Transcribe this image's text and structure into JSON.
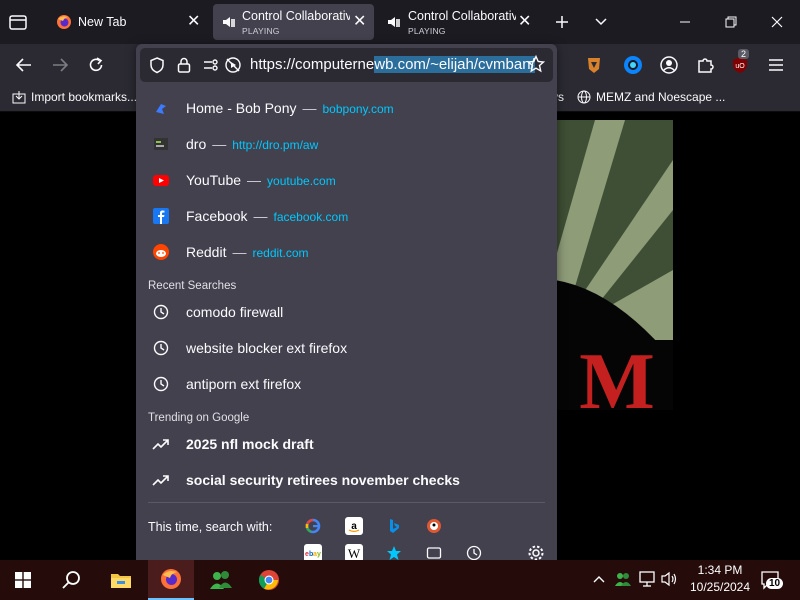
{
  "tabs": [
    {
      "title": "New Tab",
      "active": false
    },
    {
      "title": "Control Collaborativ",
      "subtitle": "PLAYING",
      "active": true
    },
    {
      "title": "Control Collaborativ",
      "subtitle": "PLAYING",
      "active": false
    }
  ],
  "url": {
    "prefix": "https://computerne",
    "selected": "wb.com/~elijah/cvmban/"
  },
  "bookmarks": [
    {
      "label": "Import bookmarks..."
    },
    {
      "label": "vs"
    },
    {
      "label": "MEMZ and Noescape ..."
    }
  ],
  "extensions_badge": "2",
  "suggestions": [
    {
      "title": "Home - Bob Pony",
      "url": "bobpony.com",
      "icon": "bobpony-icon"
    },
    {
      "title": "dro",
      "url": "http://dro.pm/aw",
      "icon": "dro-icon"
    },
    {
      "title": "YouTube",
      "url": "youtube.com",
      "icon": "youtube-icon"
    },
    {
      "title": "Facebook",
      "url": "facebook.com",
      "icon": "facebook-icon"
    },
    {
      "title": "Reddit",
      "url": "reddit.com",
      "icon": "reddit-icon"
    }
  ],
  "recent_label": "Recent Searches",
  "recent": [
    {
      "text": "comodo firewall"
    },
    {
      "text": "website blocker ext firefox"
    },
    {
      "text": "antiporn ext firefox"
    }
  ],
  "trending_label": "Trending on Google",
  "trending": [
    {
      "text": "2025 nfl mock draft"
    },
    {
      "text": "social security retirees november checks"
    }
  ],
  "search_with_label": "This time, search with:",
  "engines_row1": [
    "google-icon",
    "amazon-icon",
    "bing-icon",
    "duckduckgo-icon"
  ],
  "engines_row2": [
    "ebay-icon",
    "wikipedia-icon",
    "bookmarks-star-icon",
    "tabs-icon",
    "history-icon"
  ],
  "art_text": "M",
  "clock": {
    "time": "1:34 PM",
    "date": "10/25/2024"
  },
  "notification_count": "10",
  "colors": {
    "accent": "#00c8ff",
    "selection": "#2b6e9c",
    "taskbar": "#260b0b"
  }
}
